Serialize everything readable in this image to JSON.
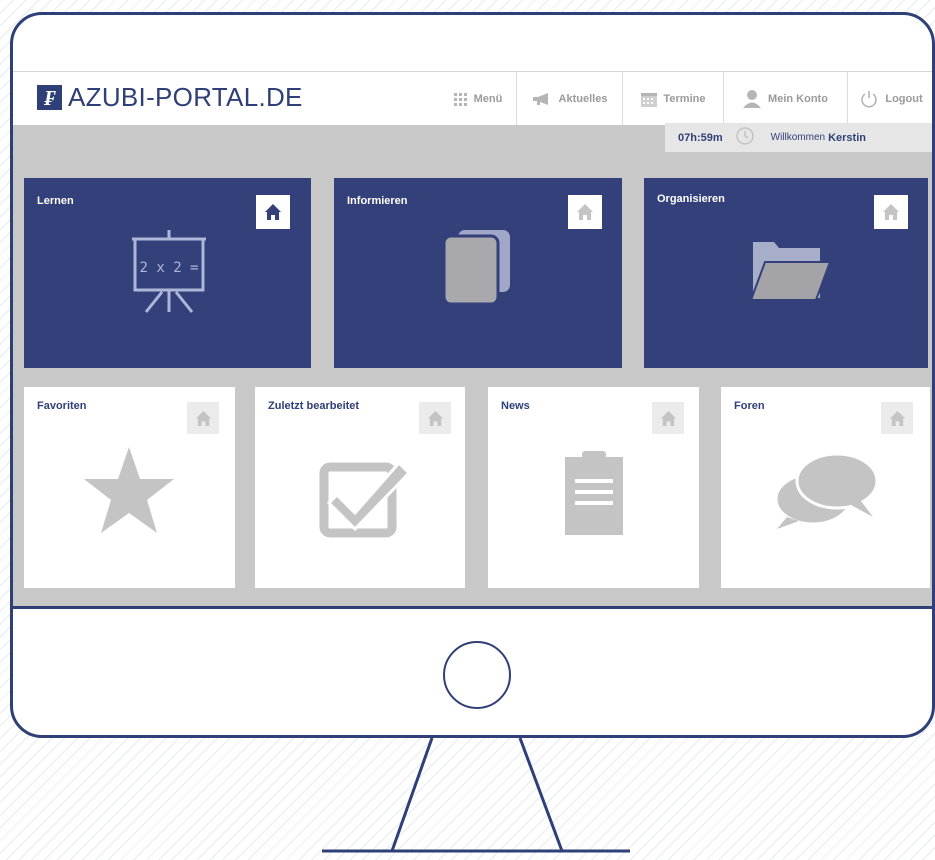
{
  "logo": {
    "mark": "₣",
    "text": "AZUBI-PORTAL.DE"
  },
  "nav": [
    {
      "label": "Menü",
      "icon": "grid-icon"
    },
    {
      "label": "Aktuelles",
      "icon": "megaphone-icon"
    },
    {
      "label": "Termine",
      "icon": "calendar-icon"
    },
    {
      "label": "Mein Konto",
      "icon": "user-icon"
    },
    {
      "label": "Logout",
      "icon": "power-icon"
    }
  ],
  "status": {
    "timer": "07h:59m",
    "welcome_prefix": "Willkommen",
    "user_name": "Kerstin"
  },
  "tiles_top": [
    {
      "title": "Lernen",
      "icon": "chalkboard-icon",
      "board_text": "2 x 2 ="
    },
    {
      "title": "Informieren",
      "icon": "documents-icon"
    },
    {
      "title": "Organisieren",
      "icon": "folder-icon"
    }
  ],
  "tiles_bottom": [
    {
      "title": "Favoriten",
      "icon": "star-icon"
    },
    {
      "title": "Zuletzt bearbeitet",
      "icon": "checkbox-icon"
    },
    {
      "title": "News",
      "icon": "clipboard-icon"
    },
    {
      "title": "Foren",
      "icon": "chat-bubbles-icon"
    }
  ],
  "colors": {
    "brand": "#33407a",
    "panel": "#c8c8c8",
    "icon_gray": "#c4c4c4"
  }
}
